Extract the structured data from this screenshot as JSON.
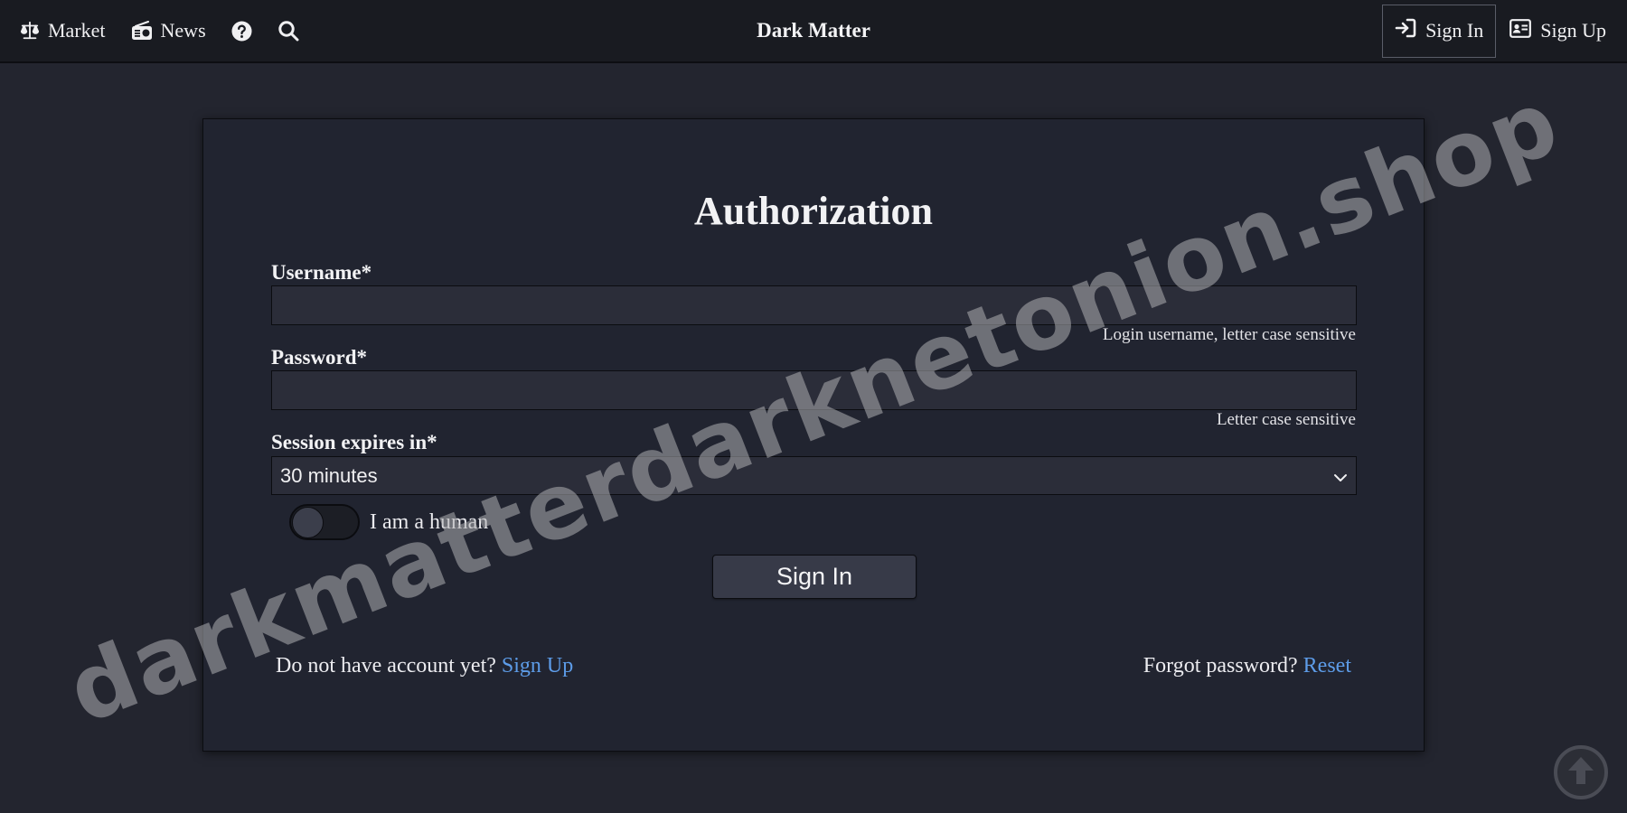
{
  "nav": {
    "market_label": "Market",
    "news_label": "News",
    "brand": "Dark Matter",
    "signin_label": "Sign In",
    "signup_label": "Sign Up",
    "icons": [
      "scales-icon",
      "radio-icon",
      "help-icon",
      "search-icon",
      "sign-in-icon",
      "id-card-icon"
    ]
  },
  "form": {
    "title": "Authorization",
    "username_label": "Username*",
    "username_value": "",
    "username_hint": "Login username, letter case sensitive",
    "password_label": "Password*",
    "password_value": "",
    "password_hint": "Letter case sensitive",
    "session_label": "Session expires in*",
    "session_value": "30 minutes",
    "human_label": "I am a human",
    "human_checked": false,
    "submit_label": "Sign In"
  },
  "footer": {
    "no_account_text": "Do not have account yet?",
    "signup_link": "Sign Up",
    "forgot_text": "Forgot password?",
    "reset_link": "Reset"
  },
  "watermark": "darkmatterdarknetonion.shop",
  "colors": {
    "background": "#23252f",
    "topbar": "#191b21",
    "card": "#212430",
    "input": "#2b2d39",
    "link": "#5d9ce8",
    "button": "#373a48"
  }
}
